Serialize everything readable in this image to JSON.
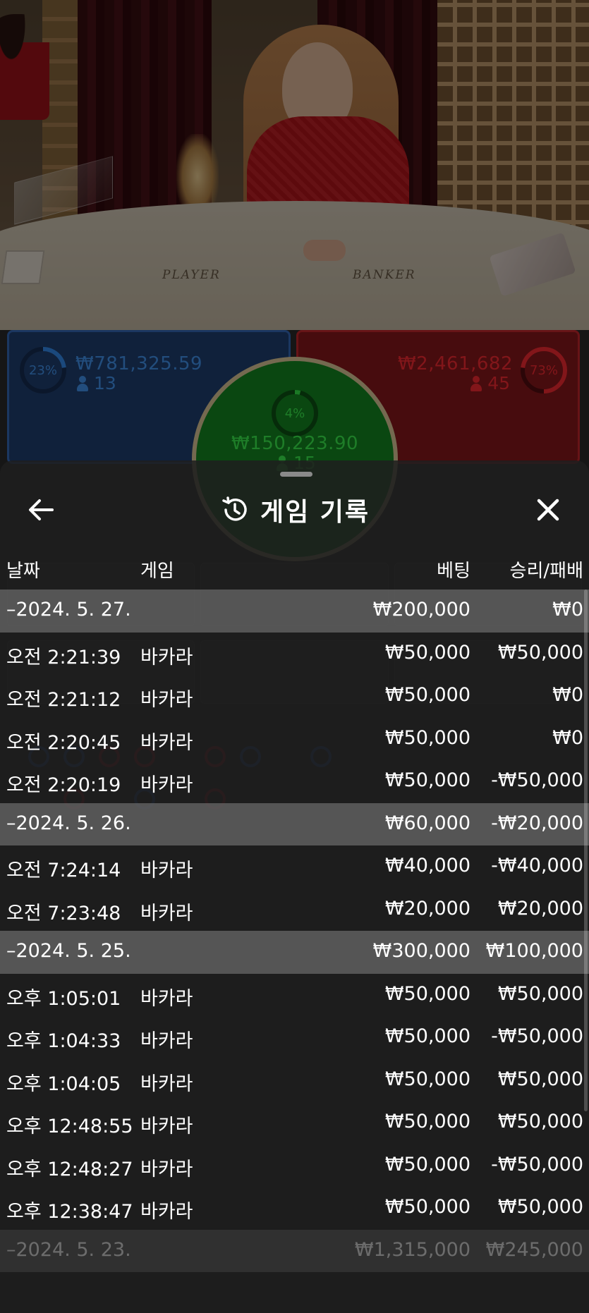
{
  "video": {
    "table_label_player": "PLAYER",
    "table_label_banker": "BANKER"
  },
  "bets": {
    "player": {
      "percent_label": "23%",
      "percent": 23,
      "amount": "₩781,325.59",
      "players": "13",
      "color": "#2f7fd8"
    },
    "tie": {
      "percent_label": "4%",
      "percent": 4,
      "amount": "₩150,223.90",
      "players": "15",
      "color": "#2fd040"
    },
    "banker": {
      "percent_label": "73%",
      "percent": 73,
      "amount": "₩2,461,682",
      "players": "45",
      "color": "#e0262d"
    }
  },
  "modal": {
    "title": "게임 기록",
    "title_icon": "history-icon",
    "back_icon": "arrow-left-icon",
    "close_icon": "close-icon",
    "columns": {
      "date": "날짜",
      "game": "게임",
      "bet": "베팅",
      "result": "승리/패배"
    },
    "groups": [
      {
        "date": "–2024. 5. 27.",
        "bet_total": "₩200,000",
        "result_total": "₩0",
        "rows": [
          {
            "time": "오전 2:21:39",
            "game": "바카라",
            "bet": "₩50,000",
            "result": "₩50,000"
          },
          {
            "time": "오전 2:21:12",
            "game": "바카라",
            "bet": "₩50,000",
            "result": "₩0"
          },
          {
            "time": "오전 2:20:45",
            "game": "바카라",
            "bet": "₩50,000",
            "result": "₩0"
          },
          {
            "time": "오전 2:20:19",
            "game": "바카라",
            "bet": "₩50,000",
            "result": "-₩50,000"
          }
        ]
      },
      {
        "date": "–2024. 5. 26.",
        "bet_total": "₩60,000",
        "result_total": "-₩20,000",
        "rows": [
          {
            "time": "오전 7:24:14",
            "game": "바카라",
            "bet": "₩40,000",
            "result": "-₩40,000"
          },
          {
            "time": "오전 7:23:48",
            "game": "바카라",
            "bet": "₩20,000",
            "result": "₩20,000"
          }
        ]
      },
      {
        "date": "–2024. 5. 25.",
        "bet_total": "₩300,000",
        "result_total": "₩100,000",
        "rows": [
          {
            "time": "오후 1:05:01",
            "game": "바카라",
            "bet": "₩50,000",
            "result": "₩50,000"
          },
          {
            "time": "오후 1:04:33",
            "game": "바카라",
            "bet": "₩50,000",
            "result": "-₩50,000"
          },
          {
            "time": "오후 1:04:05",
            "game": "바카라",
            "bet": "₩50,000",
            "result": "₩50,000"
          },
          {
            "time": "오후 12:48:55",
            "game": "바카라",
            "bet": "₩50,000",
            "result": "₩50,000"
          },
          {
            "time": "오후 12:48:27",
            "game": "바카라",
            "bet": "₩50,000",
            "result": "-₩50,000"
          },
          {
            "time": "오후 12:38:47",
            "game": "바카라",
            "bet": "₩50,000",
            "result": "₩50,000"
          }
        ]
      },
      {
        "date": "–2024. 5. 23.",
        "bet_total": "₩1,315,000",
        "result_total": "₩245,000",
        "rows": []
      }
    ]
  }
}
